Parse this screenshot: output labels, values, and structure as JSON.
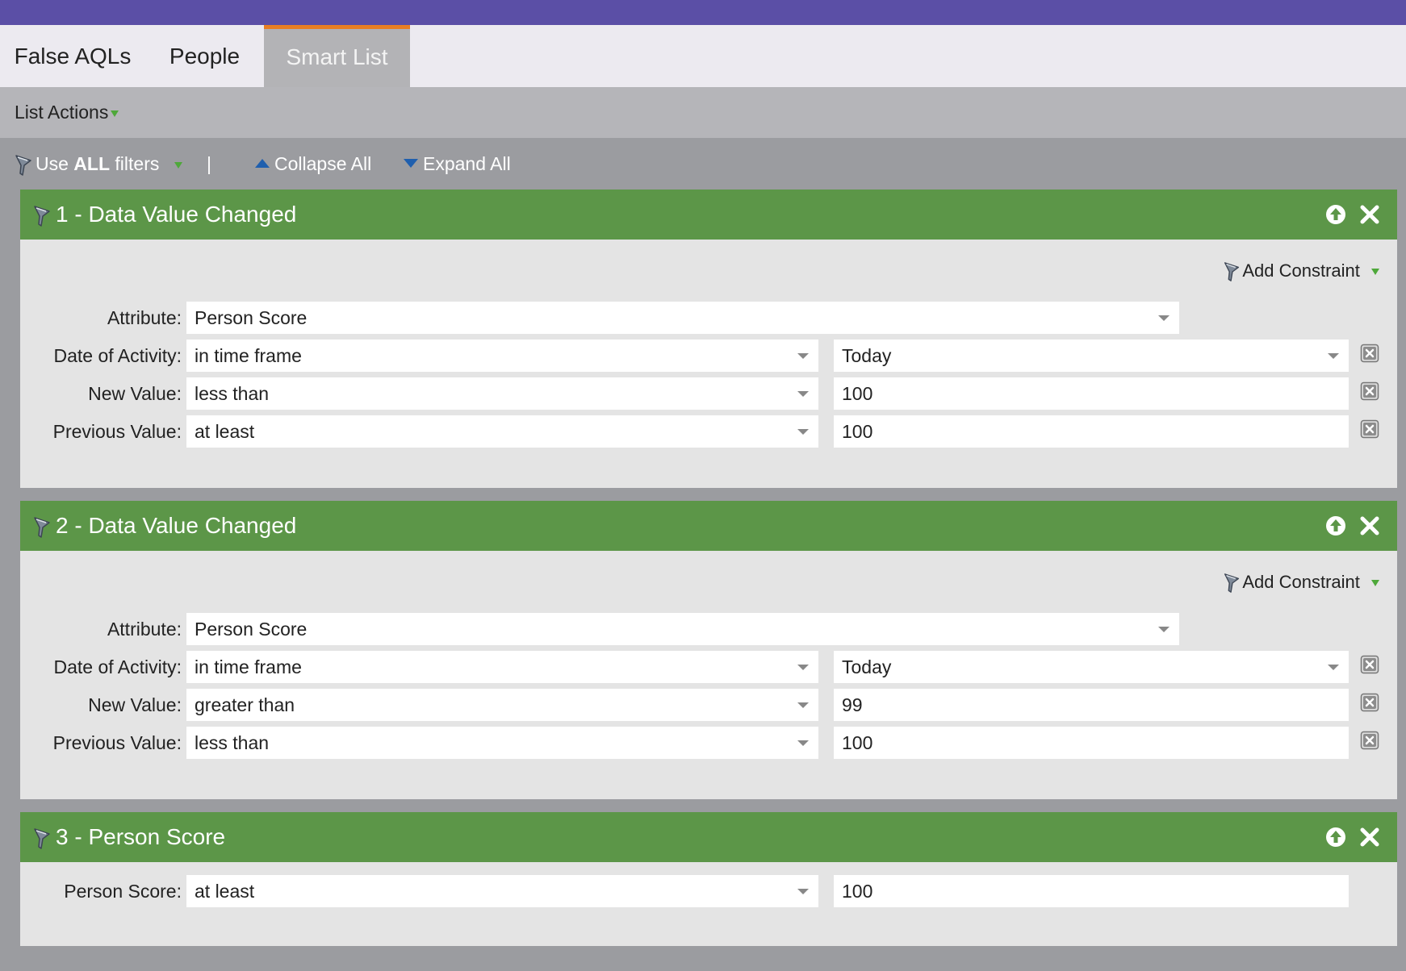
{
  "tabs": [
    {
      "label": "False AQLs"
    },
    {
      "label": "People"
    },
    {
      "label": "Smart List"
    }
  ],
  "list_actions_label": "List Actions",
  "toolbar": {
    "use_prefix": "Use ",
    "use_bold": "ALL",
    "use_suffix": " filters",
    "separator": "|",
    "collapse_label": "Collapse All",
    "expand_label": "Expand All"
  },
  "colors": {
    "topbar": "#5b4fa6",
    "active_tab_accent": "#e97e22",
    "filter_header": "#5c9648",
    "toolbar_triangle": "#1f5fae"
  },
  "filters": [
    {
      "title": "1 - Data Value Changed",
      "add_constraint": "Add Constraint",
      "attribute_label": "Attribute:",
      "attribute_value": "Person Score",
      "rows": [
        {
          "label": "Date of Activity:",
          "operator": "in time frame",
          "value": "Today"
        },
        {
          "label": "New Value:",
          "operator": "less than",
          "value": "100"
        },
        {
          "label": "Previous Value:",
          "operator": "at least",
          "value": "100"
        }
      ]
    },
    {
      "title": "2 - Data Value Changed",
      "add_constraint": "Add Constraint",
      "attribute_label": "Attribute:",
      "attribute_value": "Person Score",
      "rows": [
        {
          "label": "Date of Activity:",
          "operator": "in time frame",
          "value": "Today"
        },
        {
          "label": "New Value:",
          "operator": "greater than",
          "value": "99"
        },
        {
          "label": "Previous Value:",
          "operator": "less than",
          "value": "100"
        }
      ]
    },
    {
      "title": "3 - Person Score",
      "rows": [
        {
          "label": "Person Score:",
          "operator": "at least",
          "value": "100"
        }
      ]
    }
  ]
}
